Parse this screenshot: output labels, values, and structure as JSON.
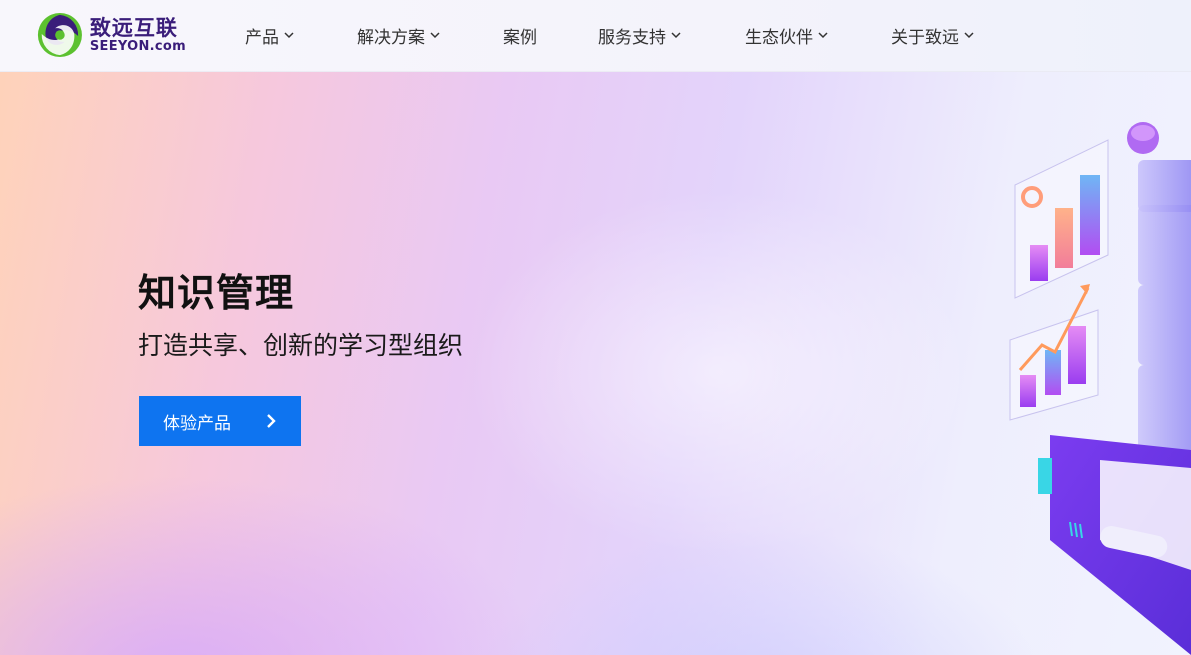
{
  "header": {
    "logo": {
      "cn": "致远互联",
      "en": "SEEYON.com"
    },
    "nav": [
      {
        "label": "产品",
        "has_dropdown": true
      },
      {
        "label": "解决方案",
        "has_dropdown": true
      },
      {
        "label": "案例",
        "has_dropdown": false
      },
      {
        "label": "服务支持",
        "has_dropdown": true
      },
      {
        "label": "生态伙伴",
        "has_dropdown": true
      },
      {
        "label": "关于致远",
        "has_dropdown": true
      }
    ]
  },
  "hero": {
    "title": "知识管理",
    "subtitle": "打造共享、创新的学习型组织",
    "cta_label": "体验产品"
  },
  "colors": {
    "accent": "#0e74f0",
    "logo_purple": "#3a1d7a",
    "logo_green": "#5cc12f"
  }
}
